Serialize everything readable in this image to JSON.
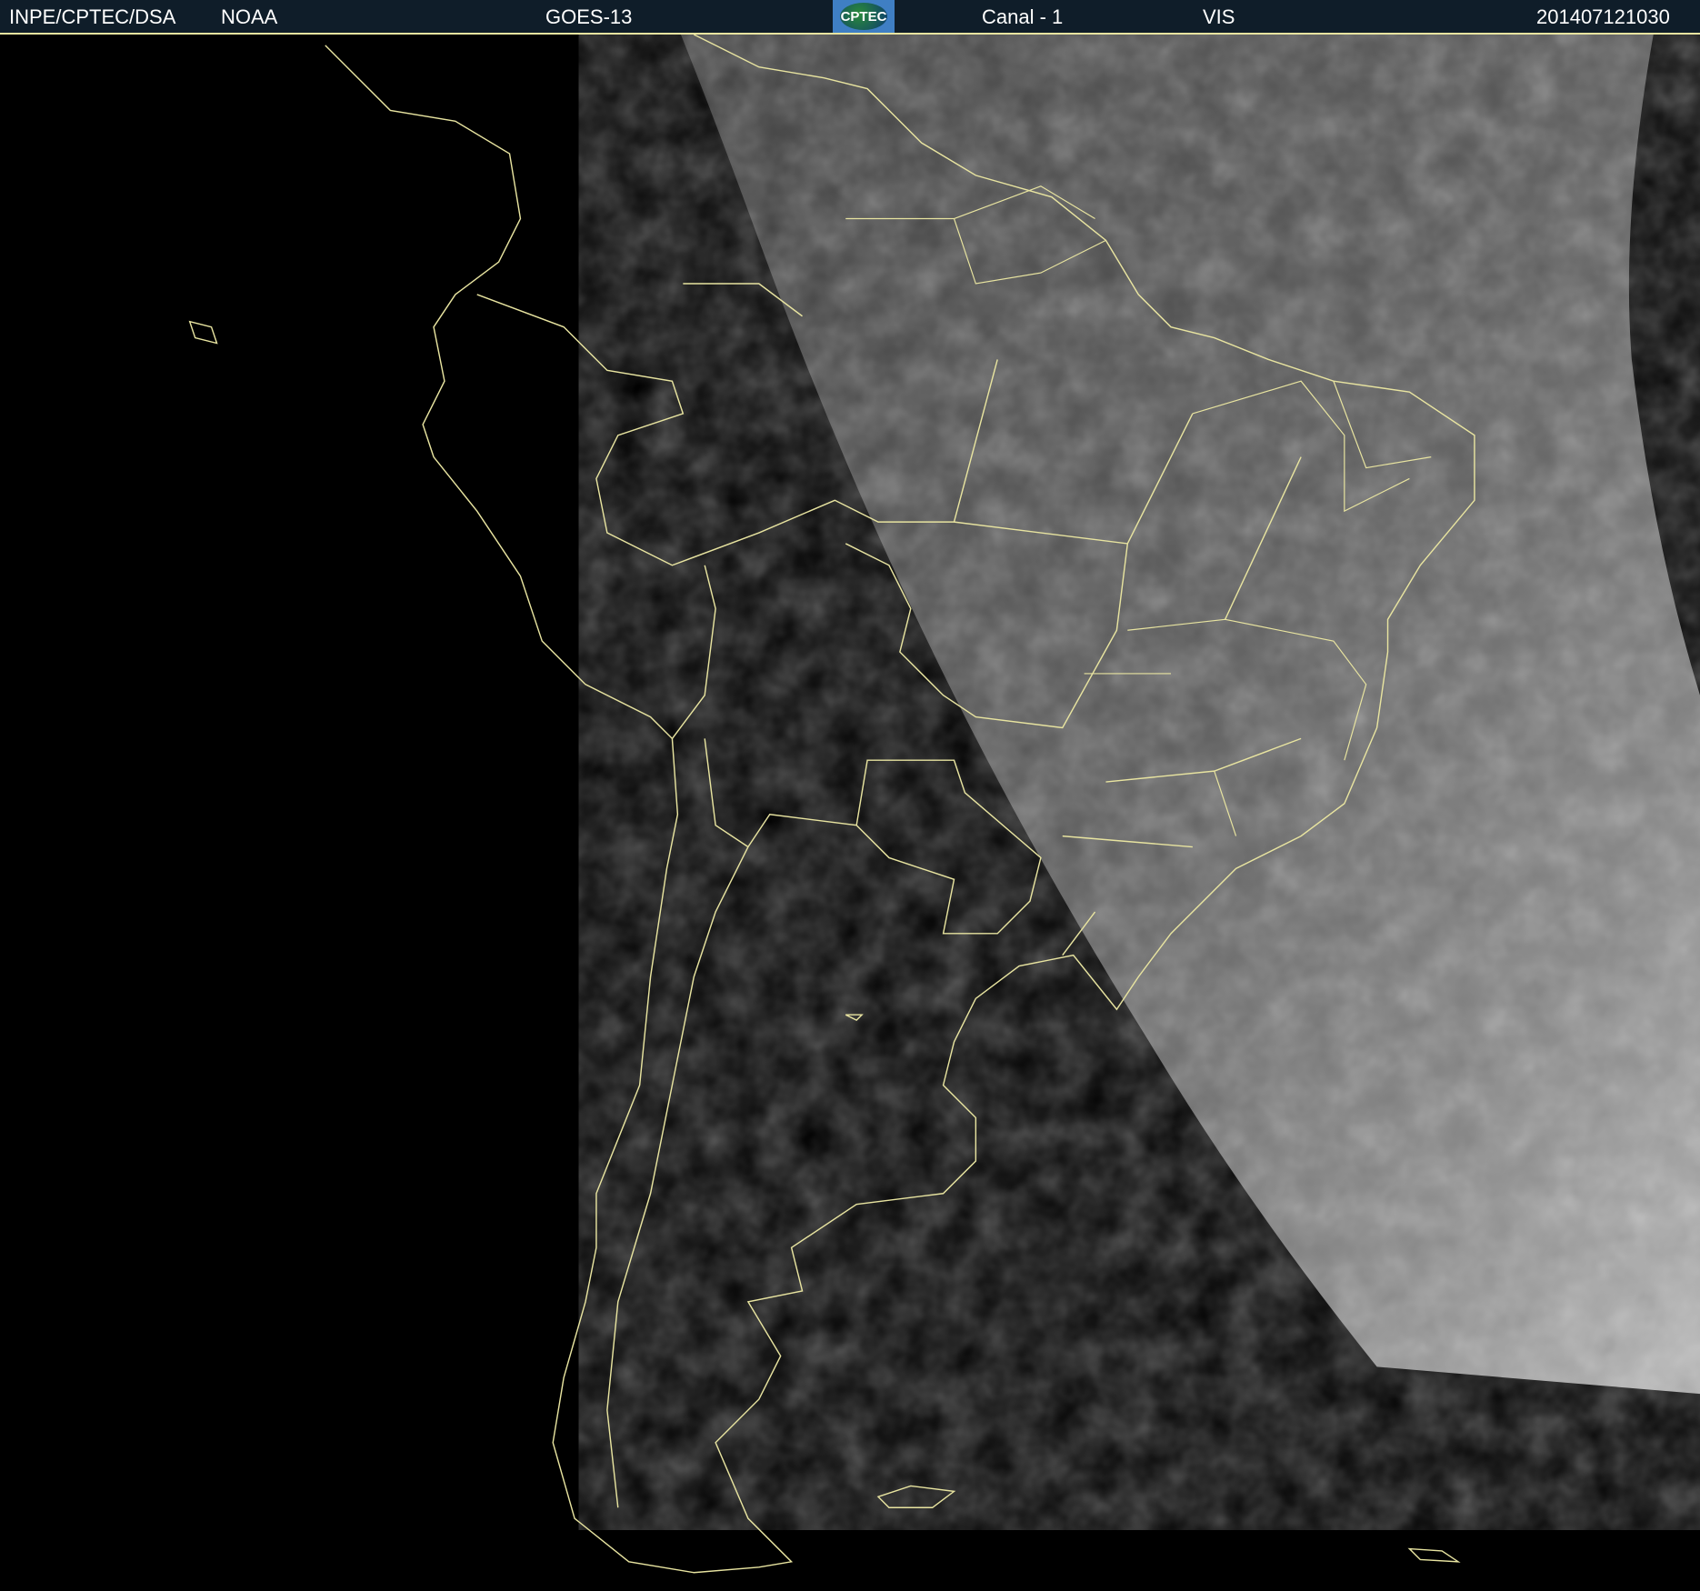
{
  "header": {
    "institution": "INPE/CPTEC/DSA",
    "agency": "NOAA",
    "satellite": "GOES-13",
    "logo_text": "CPTEC",
    "channel": "Canal - 1",
    "band": "VIS",
    "timestamp": "201407121030"
  },
  "colors": {
    "header_bg": "#0f1d29",
    "outline": "#e8e4a0",
    "cloud_gray": "#5a5a5a"
  }
}
